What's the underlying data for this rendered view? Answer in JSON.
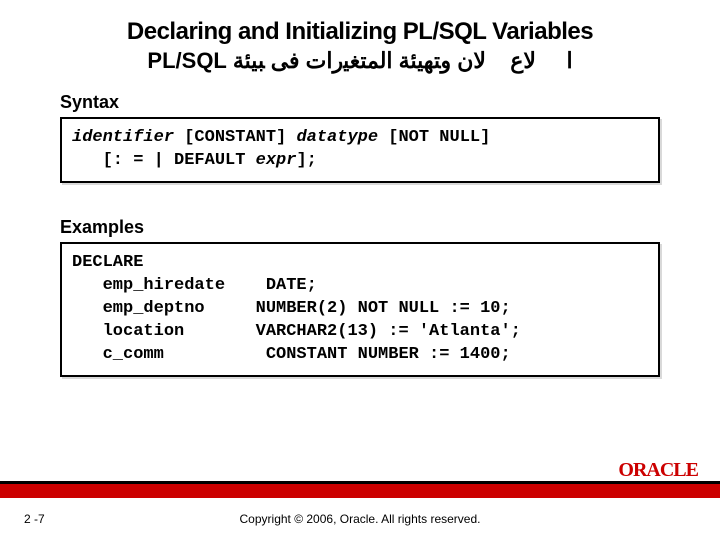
{
  "title": "Declaring and Initializing PL/SQL Variables",
  "subtitle_plsql": "PL/SQL",
  "subtitle_ar": "ﻻﻥ ﻭﺘﻬﻴﺌﺔ ﺍﻟﻤﺘﻐﻴﺭﺍﺕ ﻓﻰ ﺒﻴﺌﺔ",
  "subtitle_ar2": "ﻻﻉ",
  "subtitle_ar3": "ﺍ",
  "syntax_label": "Syntax",
  "syntax_line1a": "identifier",
  "syntax_line1b": " [CONSTANT] ",
  "syntax_line1c": "datatype",
  "syntax_line1d": " [NOT NULL]",
  "syntax_line2a": "   [: = | DEFAULT ",
  "syntax_line2b": "expr",
  "syntax_line2c": "];",
  "examples_label": "Examples",
  "ex_line1": "DECLARE",
  "ex_line2": "   emp_hiredate    DATE;",
  "ex_line3": "   emp_deptno     NUMBER(2) NOT NULL := 10;",
  "ex_line4": "   location       VARCHAR2(13) := 'Atlanta';",
  "ex_line5": "   c_comm          CONSTANT NUMBER := 1400;",
  "page_number": "2 -7",
  "copyright": "Copyright © 2006, Oracle.  All rights reserved.",
  "logo_text": "ORACLE"
}
